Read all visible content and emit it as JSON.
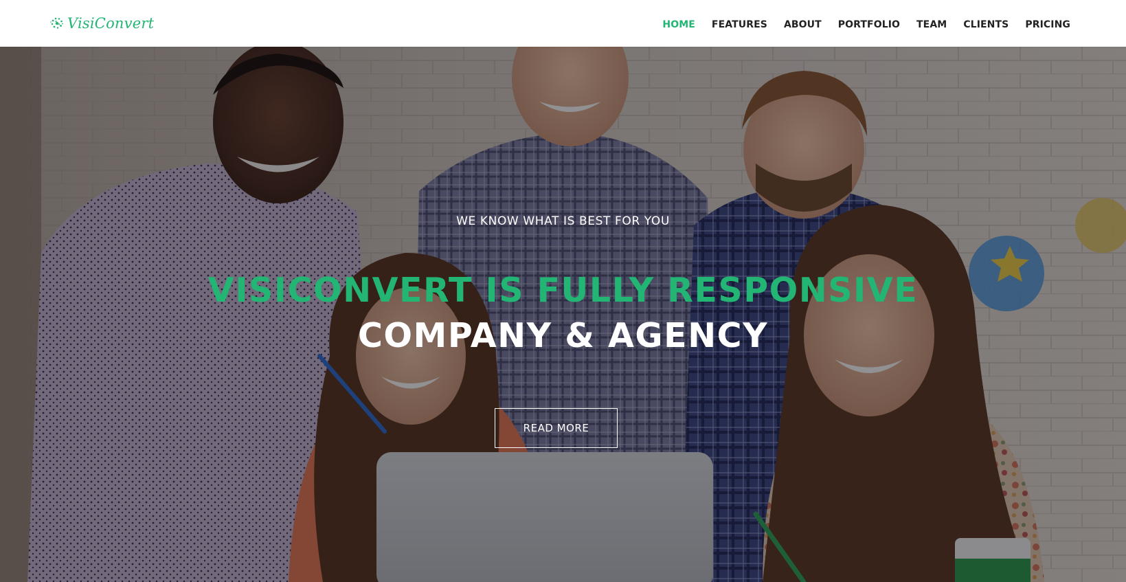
{
  "brand": {
    "name": "VisiConvert",
    "icon": "dots-cluster-logo-icon",
    "color": "#22b573"
  },
  "nav": {
    "items": [
      {
        "label": "HOME",
        "active": true
      },
      {
        "label": "FEATURES",
        "active": false
      },
      {
        "label": "ABOUT",
        "active": false
      },
      {
        "label": "PORTFOLIO",
        "active": false
      },
      {
        "label": "TEAM",
        "active": false
      },
      {
        "label": "CLIENTS",
        "active": false
      },
      {
        "label": "PRICING",
        "active": false
      }
    ],
    "active_color": "#22b573",
    "text_color": "#222222"
  },
  "hero": {
    "tagline": "WE KNOW WHAT IS BEST FOR YOU",
    "title_line1": "VISICONVERT IS FULLY RESPONSIVE",
    "title_line2": "COMPANY & AGENCY",
    "button_label": "READ MORE",
    "background": "team-photo-five-people-smiling-around-laptop"
  }
}
